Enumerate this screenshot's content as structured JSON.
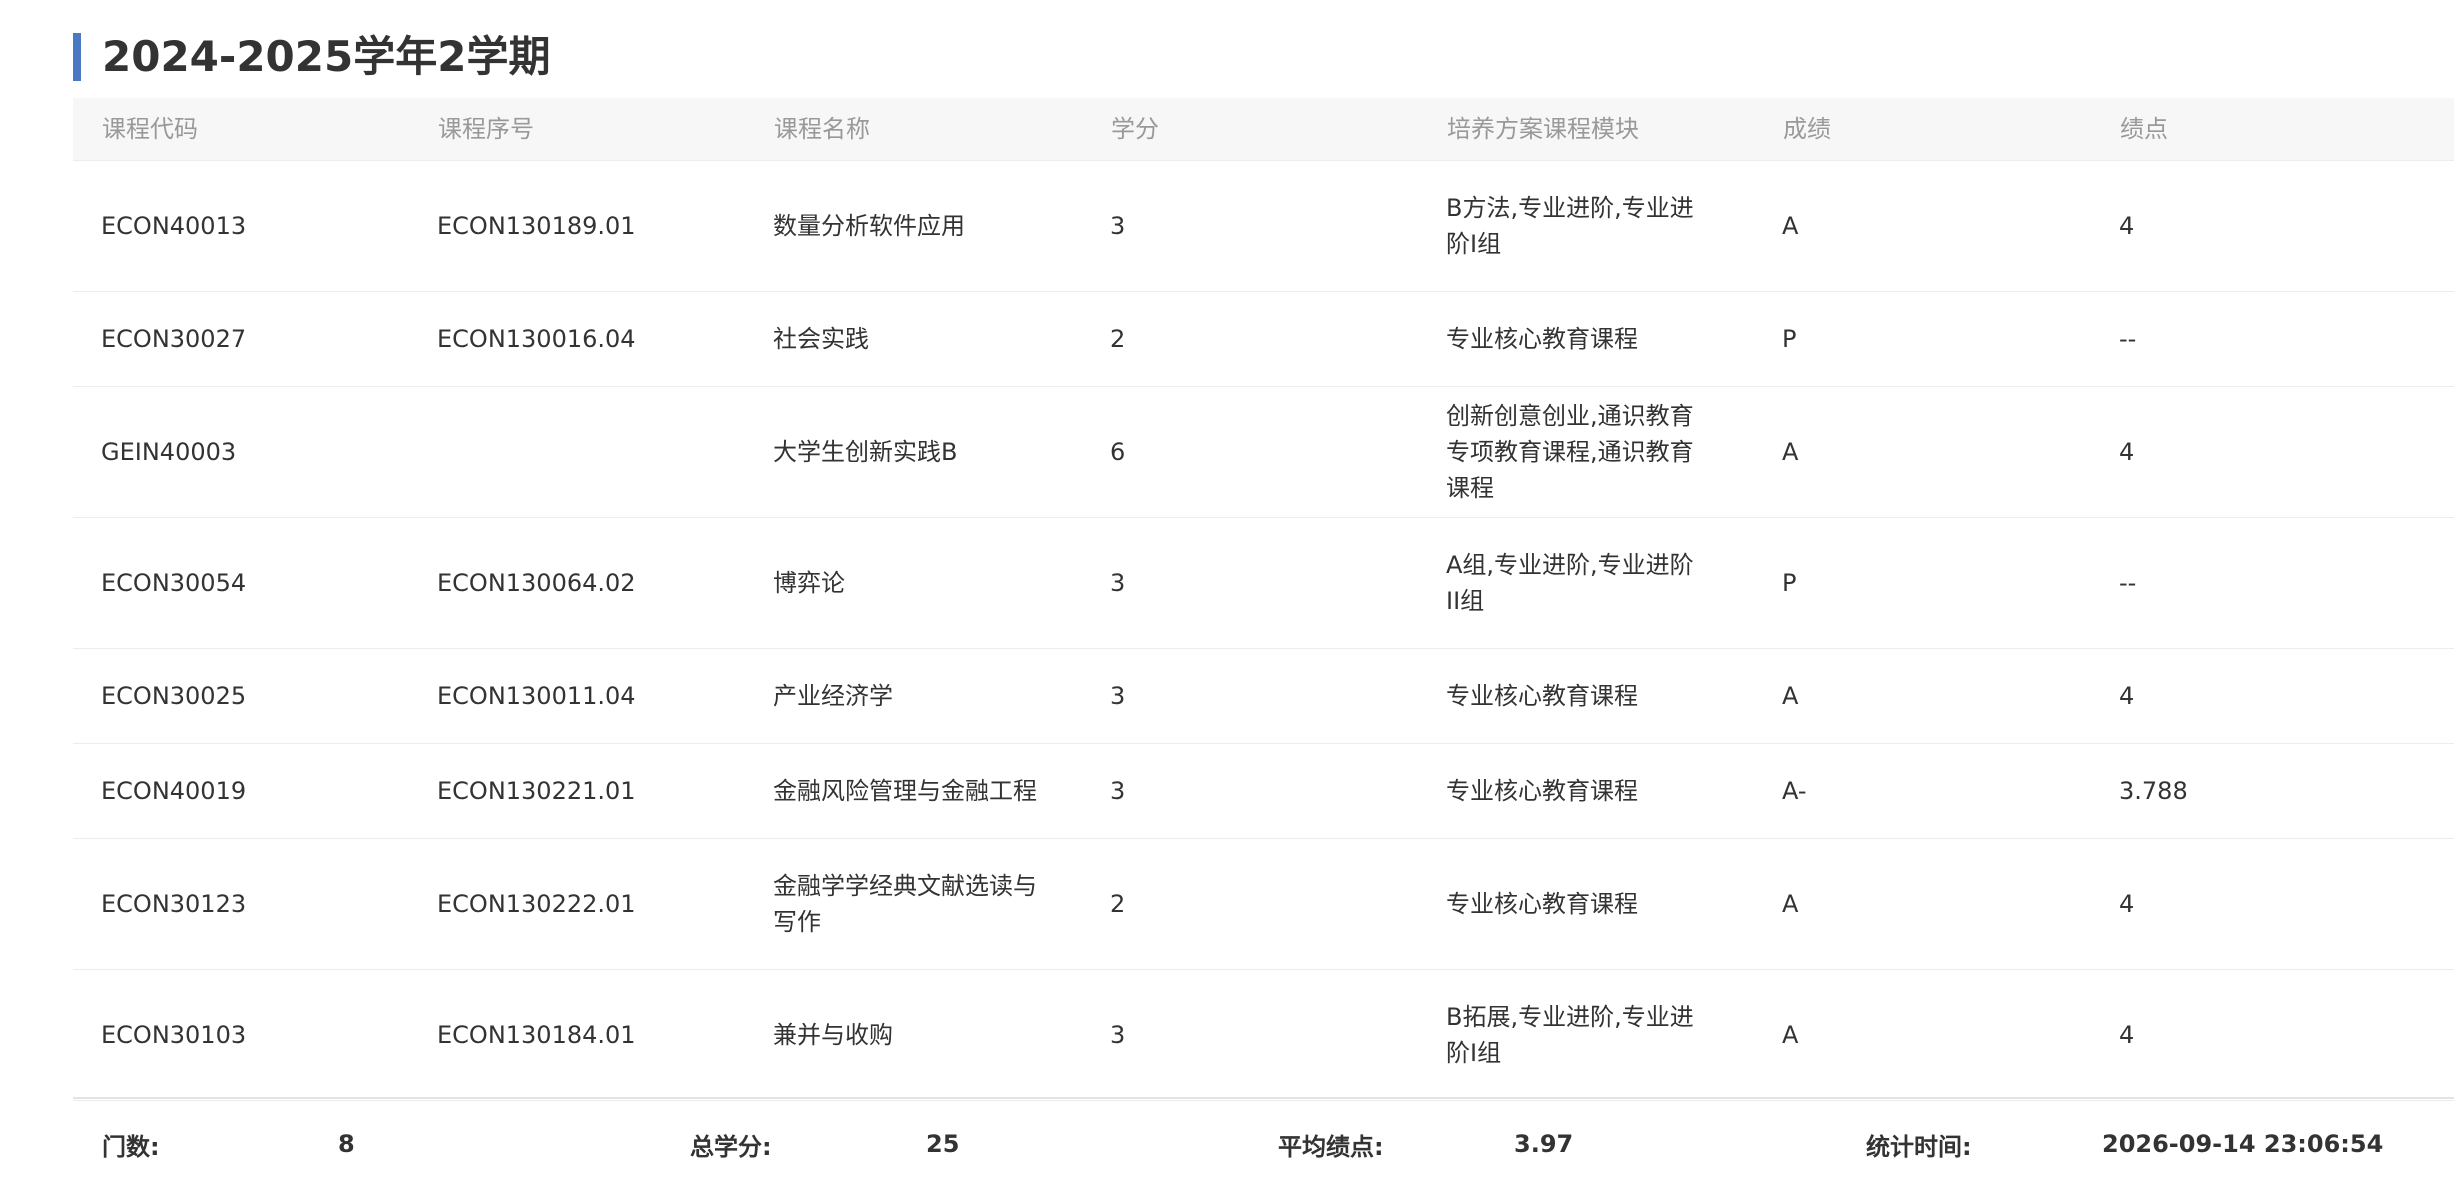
{
  "accent_color": "#4a78c2",
  "page_title": "2024-2025学年2学期",
  "table": {
    "headers": [
      "课程代码",
      "课程序号",
      "课程名称",
      "学分",
      "培养方案课程模块",
      "成绩",
      "绩点"
    ],
    "rows": [
      [
        "ECON40013",
        "ECON130189.01",
        "数量分析软件应用",
        "3",
        "B方法,专业进阶,专业进阶I组",
        "A",
        "4"
      ],
      [
        "ECON30027",
        "ECON130016.04",
        "社会实践",
        "2",
        "专业核心教育课程",
        "P",
        "--"
      ],
      [
        "GEIN40003",
        "",
        "大学生创新实践B",
        "6",
        "创新创意创业,通识教育专项教育课程,通识教育课程",
        "A",
        "4"
      ],
      [
        "ECON30054",
        "ECON130064.02",
        "博弈论",
        "3",
        "A组,专业进阶,专业进阶II组",
        "P",
        "--"
      ],
      [
        "ECON30025",
        "ECON130011.04",
        "产业经济学",
        "3",
        "专业核心教育课程",
        "A",
        "4"
      ],
      [
        "ECON40019",
        "ECON130221.01",
        "金融风险管理与金融工程",
        "3",
        "专业核心教育课程",
        "A-",
        "3.788"
      ],
      [
        "ECON30123",
        "ECON130222.01",
        "金融学学经典文献选读与写作",
        "2",
        "专业核心教育课程",
        "A",
        "4"
      ],
      [
        "ECON30103",
        "ECON130184.01",
        "兼并与收购",
        "3",
        "B拓展,专业进阶,专业进阶I组",
        "A",
        "4"
      ]
    ]
  },
  "summary": {
    "count_label": "门数:",
    "count_value": "8",
    "credits_label": "总学分:",
    "credits_value": "25",
    "gpa_label": "平均绩点:",
    "gpa_value": "3.97",
    "time_label": "统计时间:",
    "time_value": "2026-09-14 23:06:54"
  }
}
